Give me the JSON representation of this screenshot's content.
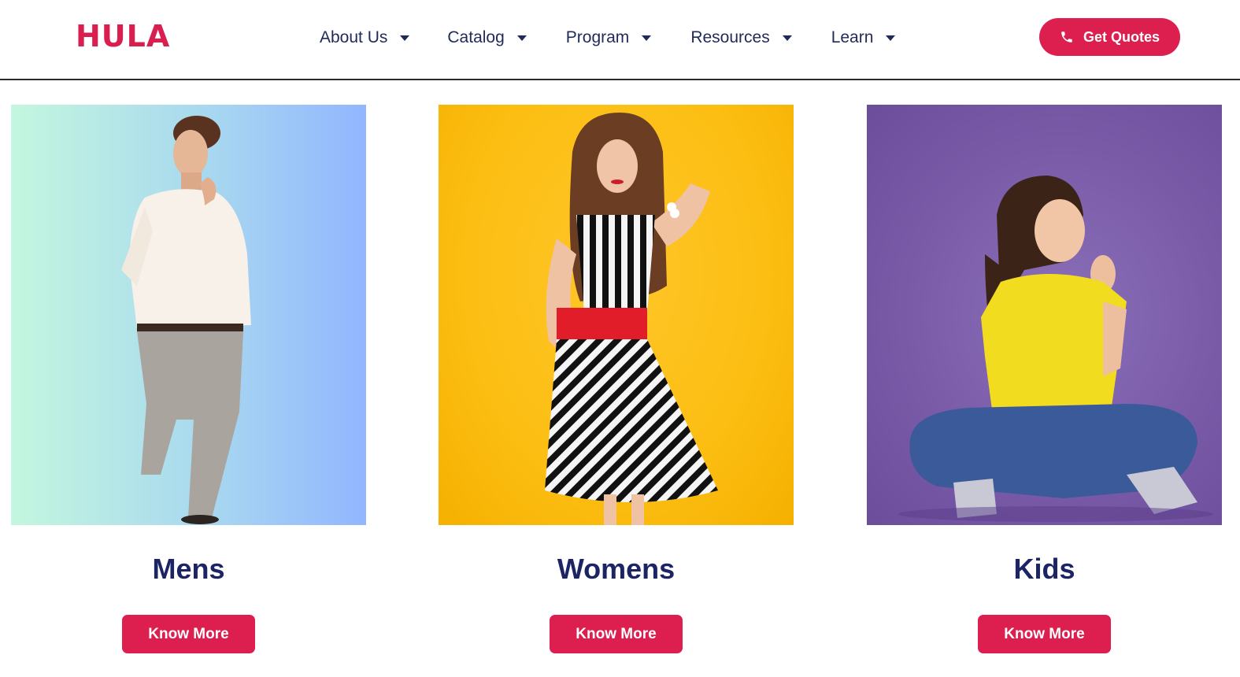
{
  "header": {
    "logo": "HULA",
    "nav": [
      {
        "label": "About Us"
      },
      {
        "label": "Catalog"
      },
      {
        "label": "Program"
      },
      {
        "label": "Resources"
      },
      {
        "label": "Learn"
      }
    ],
    "cta_label": "Get Quotes",
    "cta_icon": "phone-icon"
  },
  "cards": [
    {
      "title": "Mens",
      "button": "Know More",
      "image": "man-in-white-shirt-photo"
    },
    {
      "title": "Womens",
      "button": "Know More",
      "image": "woman-in-striped-dress-photo"
    },
    {
      "title": "Kids",
      "button": "Know More",
      "image": "girl-in-yellow-shirt-photo"
    }
  ],
  "colors": {
    "brand": "#dc1f4f",
    "heading": "#1c2464",
    "nav_text": "#1f2a5a"
  }
}
